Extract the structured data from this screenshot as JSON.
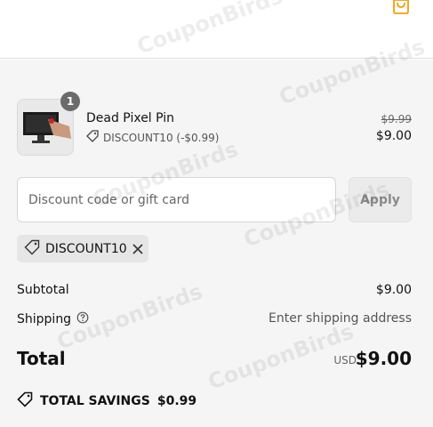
{
  "header": {
    "cart_icon": "shopping-bag-icon",
    "accent_color": "#f59e0b"
  },
  "product": {
    "name": "Dead Pixel Pin",
    "quantity": "1",
    "discount_label": "DISCOUNT10 (-$0.99)",
    "original_price": "$9.99",
    "price": "$9.00"
  },
  "discount_form": {
    "placeholder": "Discount code or gift card",
    "value": "",
    "apply_label": "Apply"
  },
  "applied_code": {
    "code": "DISCOUNT10",
    "icon": "tag-icon",
    "remove_icon": "close-icon"
  },
  "summary": {
    "subtotal_label": "Subtotal",
    "subtotal_value": "$9.00",
    "shipping_label": "Shipping",
    "shipping_value": "Enter shipping address",
    "total_label": "Total",
    "currency": "USD",
    "total_value": "$9.00",
    "savings_label": "TOTAL SAVINGS",
    "savings_value": "$0.99"
  },
  "watermark": "CouponBirds"
}
